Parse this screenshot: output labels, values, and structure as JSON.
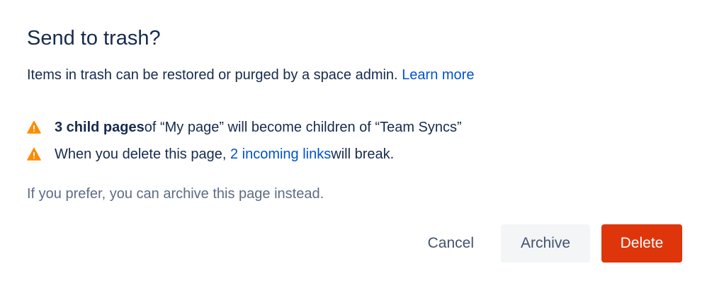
{
  "dialog": {
    "title": "Send to trash?",
    "description": "Items in trash can be restored or purged by a space admin.",
    "learn_more": "Learn more",
    "warnings": [
      {
        "icon": "warning-icon",
        "bold": "3 child pages",
        "text": " of “My page” will become children of “Team Syncs”"
      },
      {
        "icon": "warning-icon",
        "text_before": "When you delete this page,",
        "link": "2 incoming links",
        "text_after": " will break."
      }
    ],
    "hint": "If you prefer, you can archive this page instead.",
    "buttons": {
      "cancel": "Cancel",
      "archive": "Archive",
      "delete": "Delete"
    }
  },
  "colors": {
    "text": "#172B4D",
    "link": "#0052CC",
    "warning": "#FF8B00",
    "danger": "#DE350B",
    "subtle_bg": "#F4F5F7"
  }
}
